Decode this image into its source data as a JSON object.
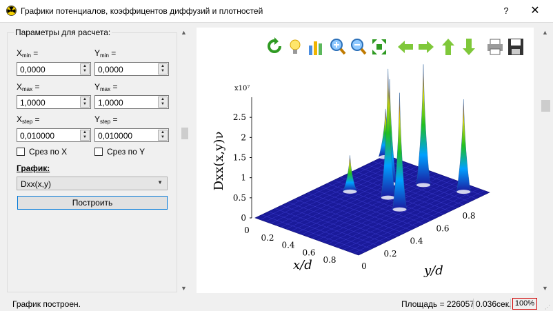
{
  "window": {
    "title": "Графики потенциалов, коэффицентов диффузий и плотностей",
    "help": "?",
    "close": "✕"
  },
  "params": {
    "group_title": "Параметры для расчета:",
    "xmin_label": "X",
    "xmin_sub": "min",
    "ymin_label": "Y",
    "ymin_sub": "min",
    "xmax_label": "X",
    "xmax_sub": "max",
    "ymax_label": "Y",
    "ymax_sub": "max",
    "xstep_label": "X",
    "xstep_sub": "step",
    "ystep_label": "Y",
    "ystep_sub": "step",
    "eq": "=",
    "xmin": "0,0000",
    "ymin": "0,0000",
    "xmax": "1,0000",
    "ymax": "1,0000",
    "xstep": "0,010000",
    "ystep": "0,010000",
    "slice_x": "Срез по X",
    "slice_y": "Срез по Y",
    "graph_label": "График:",
    "graph_selected": "Dxx(x,y)",
    "build_button": "Построить"
  },
  "toolbar": {
    "icons": [
      "refresh-icon",
      "lightbulb-icon",
      "bar-chart-icon",
      "zoom-in-icon",
      "zoom-out-icon",
      "fit-icon",
      "arrow-left-icon",
      "arrow-right-icon",
      "arrow-up-icon",
      "arrow-down-icon",
      "print-icon",
      "save-icon"
    ]
  },
  "chart_data": {
    "type": "surface",
    "zlabel": "Dxx(x,y)ν",
    "zscale": "x10⁷",
    "xlabel": "x/d",
    "ylabel": "y/d",
    "xticks": [
      "0",
      "0.2",
      "0.4",
      "0.6",
      "0.8"
    ],
    "yticks": [
      "0",
      "0.2",
      "0.4",
      "0.6",
      "0.8"
    ],
    "zticks": [
      "0",
      "0.5",
      "1",
      "1.5",
      "2",
      "2.5"
    ],
    "zlim": [
      0,
      3
    ]
  },
  "status": {
    "message": "График построен.",
    "area": "Площадь = 226057",
    "time": "0.036сек.",
    "zoom": "100%"
  },
  "colors": {
    "accent": "#0078d7",
    "surface_base": "#1a1a9a"
  }
}
